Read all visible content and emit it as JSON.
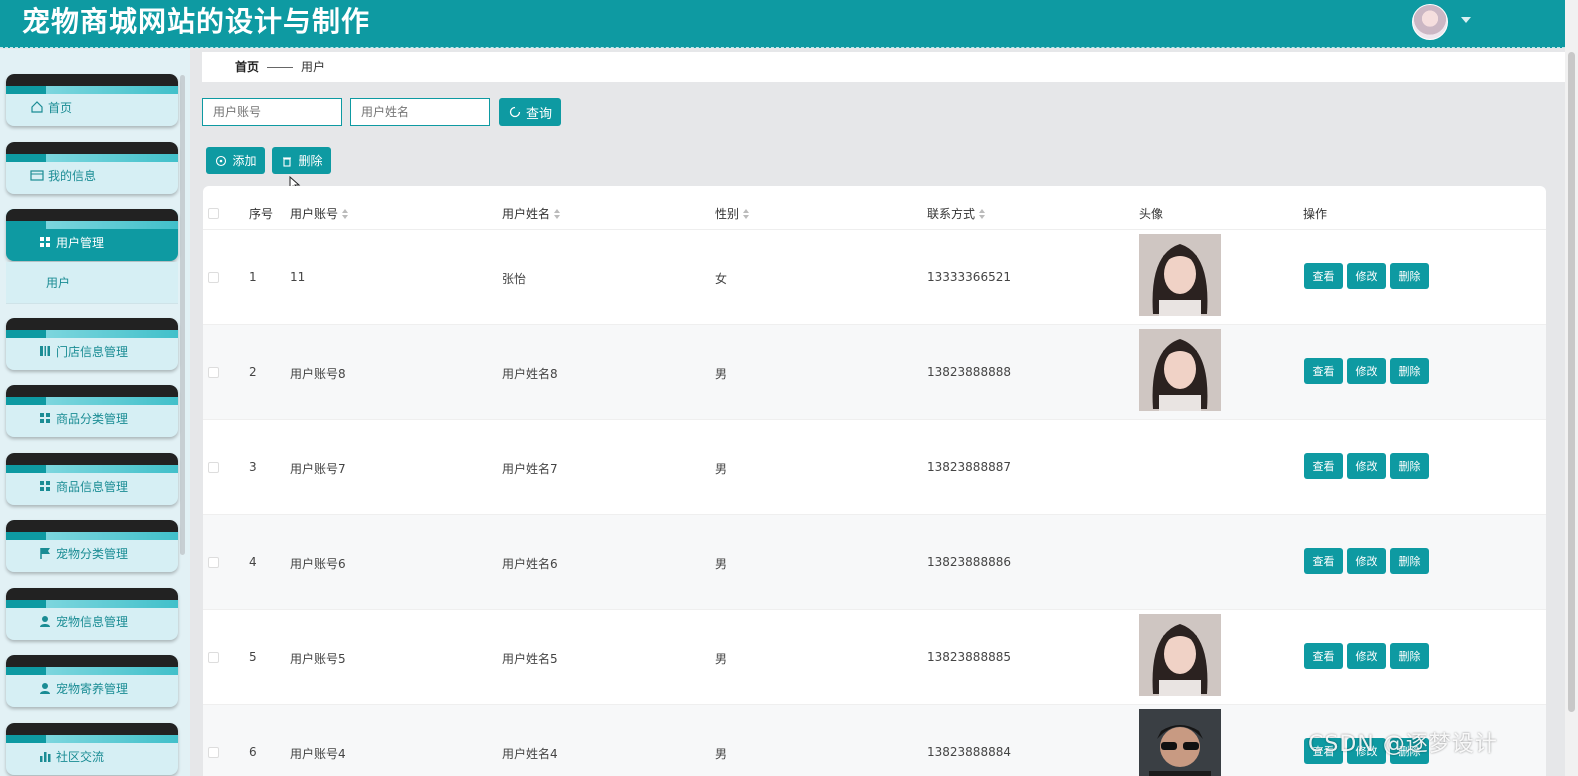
{
  "header": {
    "title": "宠物商城网站的设计与制作",
    "avatar_icon": "user-avatar",
    "dropdown_icon": "caret-down-icon"
  },
  "sidebar": {
    "items": [
      {
        "label": "首页",
        "icon": "home-icon"
      },
      {
        "label": "我的信息",
        "icon": "id-card-icon"
      },
      {
        "label": "用户管理",
        "icon": "grid-icon",
        "active": true
      },
      {
        "label": "门店信息管理",
        "icon": "store-icon"
      },
      {
        "label": "商品分类管理",
        "icon": "grid-icon"
      },
      {
        "label": "商品信息管理",
        "icon": "grid-icon"
      },
      {
        "label": "宠物分类管理",
        "icon": "flag-icon"
      },
      {
        "label": "宠物信息管理",
        "icon": "person-icon"
      },
      {
        "label": "宠物寄养管理",
        "icon": "person-icon"
      },
      {
        "label": "社区交流",
        "icon": "bar-chart-icon"
      }
    ],
    "subitem": "用户"
  },
  "breadcrumb": {
    "home": "首页",
    "current": "用户"
  },
  "search": {
    "account_placeholder": "用户账号",
    "name_placeholder": "用户姓名",
    "query_label": "查询"
  },
  "actions": {
    "add_label": "添加",
    "delete_label": "删除"
  },
  "table": {
    "columns": [
      "序号",
      "用户账号",
      "用户姓名",
      "性别",
      "联系方式",
      "头像",
      "操作"
    ],
    "rows": [
      {
        "no": "1",
        "account": "11",
        "name": "张怡",
        "gender": "女",
        "phone": "13333366521",
        "photo": "female-portrait"
      },
      {
        "no": "2",
        "account": "用户账号8",
        "name": "用户姓名8",
        "gender": "男",
        "phone": "13823888888",
        "photo": "female-portrait"
      },
      {
        "no": "3",
        "account": "用户账号7",
        "name": "用户姓名7",
        "gender": "男",
        "phone": "13823888887",
        "photo": ""
      },
      {
        "no": "4",
        "account": "用户账号6",
        "name": "用户姓名6",
        "gender": "男",
        "phone": "13823888886",
        "photo": ""
      },
      {
        "no": "5",
        "account": "用户账号5",
        "name": "用户姓名5",
        "gender": "男",
        "phone": "13823888885",
        "photo": "female-portrait"
      },
      {
        "no": "6",
        "account": "用户账号4",
        "name": "用户姓名4",
        "gender": "男",
        "phone": "13823888884",
        "photo": "male-portrait"
      }
    ],
    "op_view": "查看",
    "op_edit": "修改",
    "op_delete": "删除"
  },
  "watermark": "CSDN @逐梦设计",
  "colors": {
    "primary": "#0e9aa2",
    "sidebar_bg": "#e2f1f5"
  }
}
